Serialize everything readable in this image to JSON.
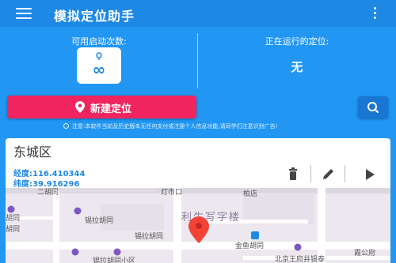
{
  "app": {
    "title": "模拟定位助手"
  },
  "top": {
    "count_label": "可用启动次数:",
    "count_value": "∞",
    "running_label": "正在运行的定位:",
    "running_value": "无"
  },
  "actions": {
    "new_label": "新建定位"
  },
  "notice": "注意:本软件当前及历史版本无任何支付或注册个人信息功能,请同学们注意识别广告!",
  "location": {
    "district": "东城区",
    "lng_label": "经度:",
    "lng_value": "116.410344",
    "lat_label": "纬度:",
    "lat_value": "39.916296"
  },
  "map_labels": {
    "l1": "利生写字楼",
    "l2": "锡拉胡同",
    "l3": "锡拉胡同",
    "l4": "金鱼胡同",
    "l5": "北京王府井银泰",
    "l6": "锡拉胡同小区",
    "l7": "胡同",
    "l8": "二胡同",
    "l9": "灯市口",
    "l10": "胡同",
    "l11": "霞公府",
    "l12": "柏店"
  },
  "colors": {
    "primary": "#2196F3",
    "appbar": "#1E88E5",
    "accent_pink": "#F0245E",
    "search_button": "#1976D2",
    "coord_text": "#1E88E5"
  },
  "icons": {
    "menu": "menu-icon",
    "more": "more-vertical-icon",
    "infinity": "infinity-icon",
    "pin": "location-pin-icon",
    "search": "search-icon",
    "delete": "trash-icon",
    "edit": "pencil-icon",
    "start": "play-icon"
  }
}
